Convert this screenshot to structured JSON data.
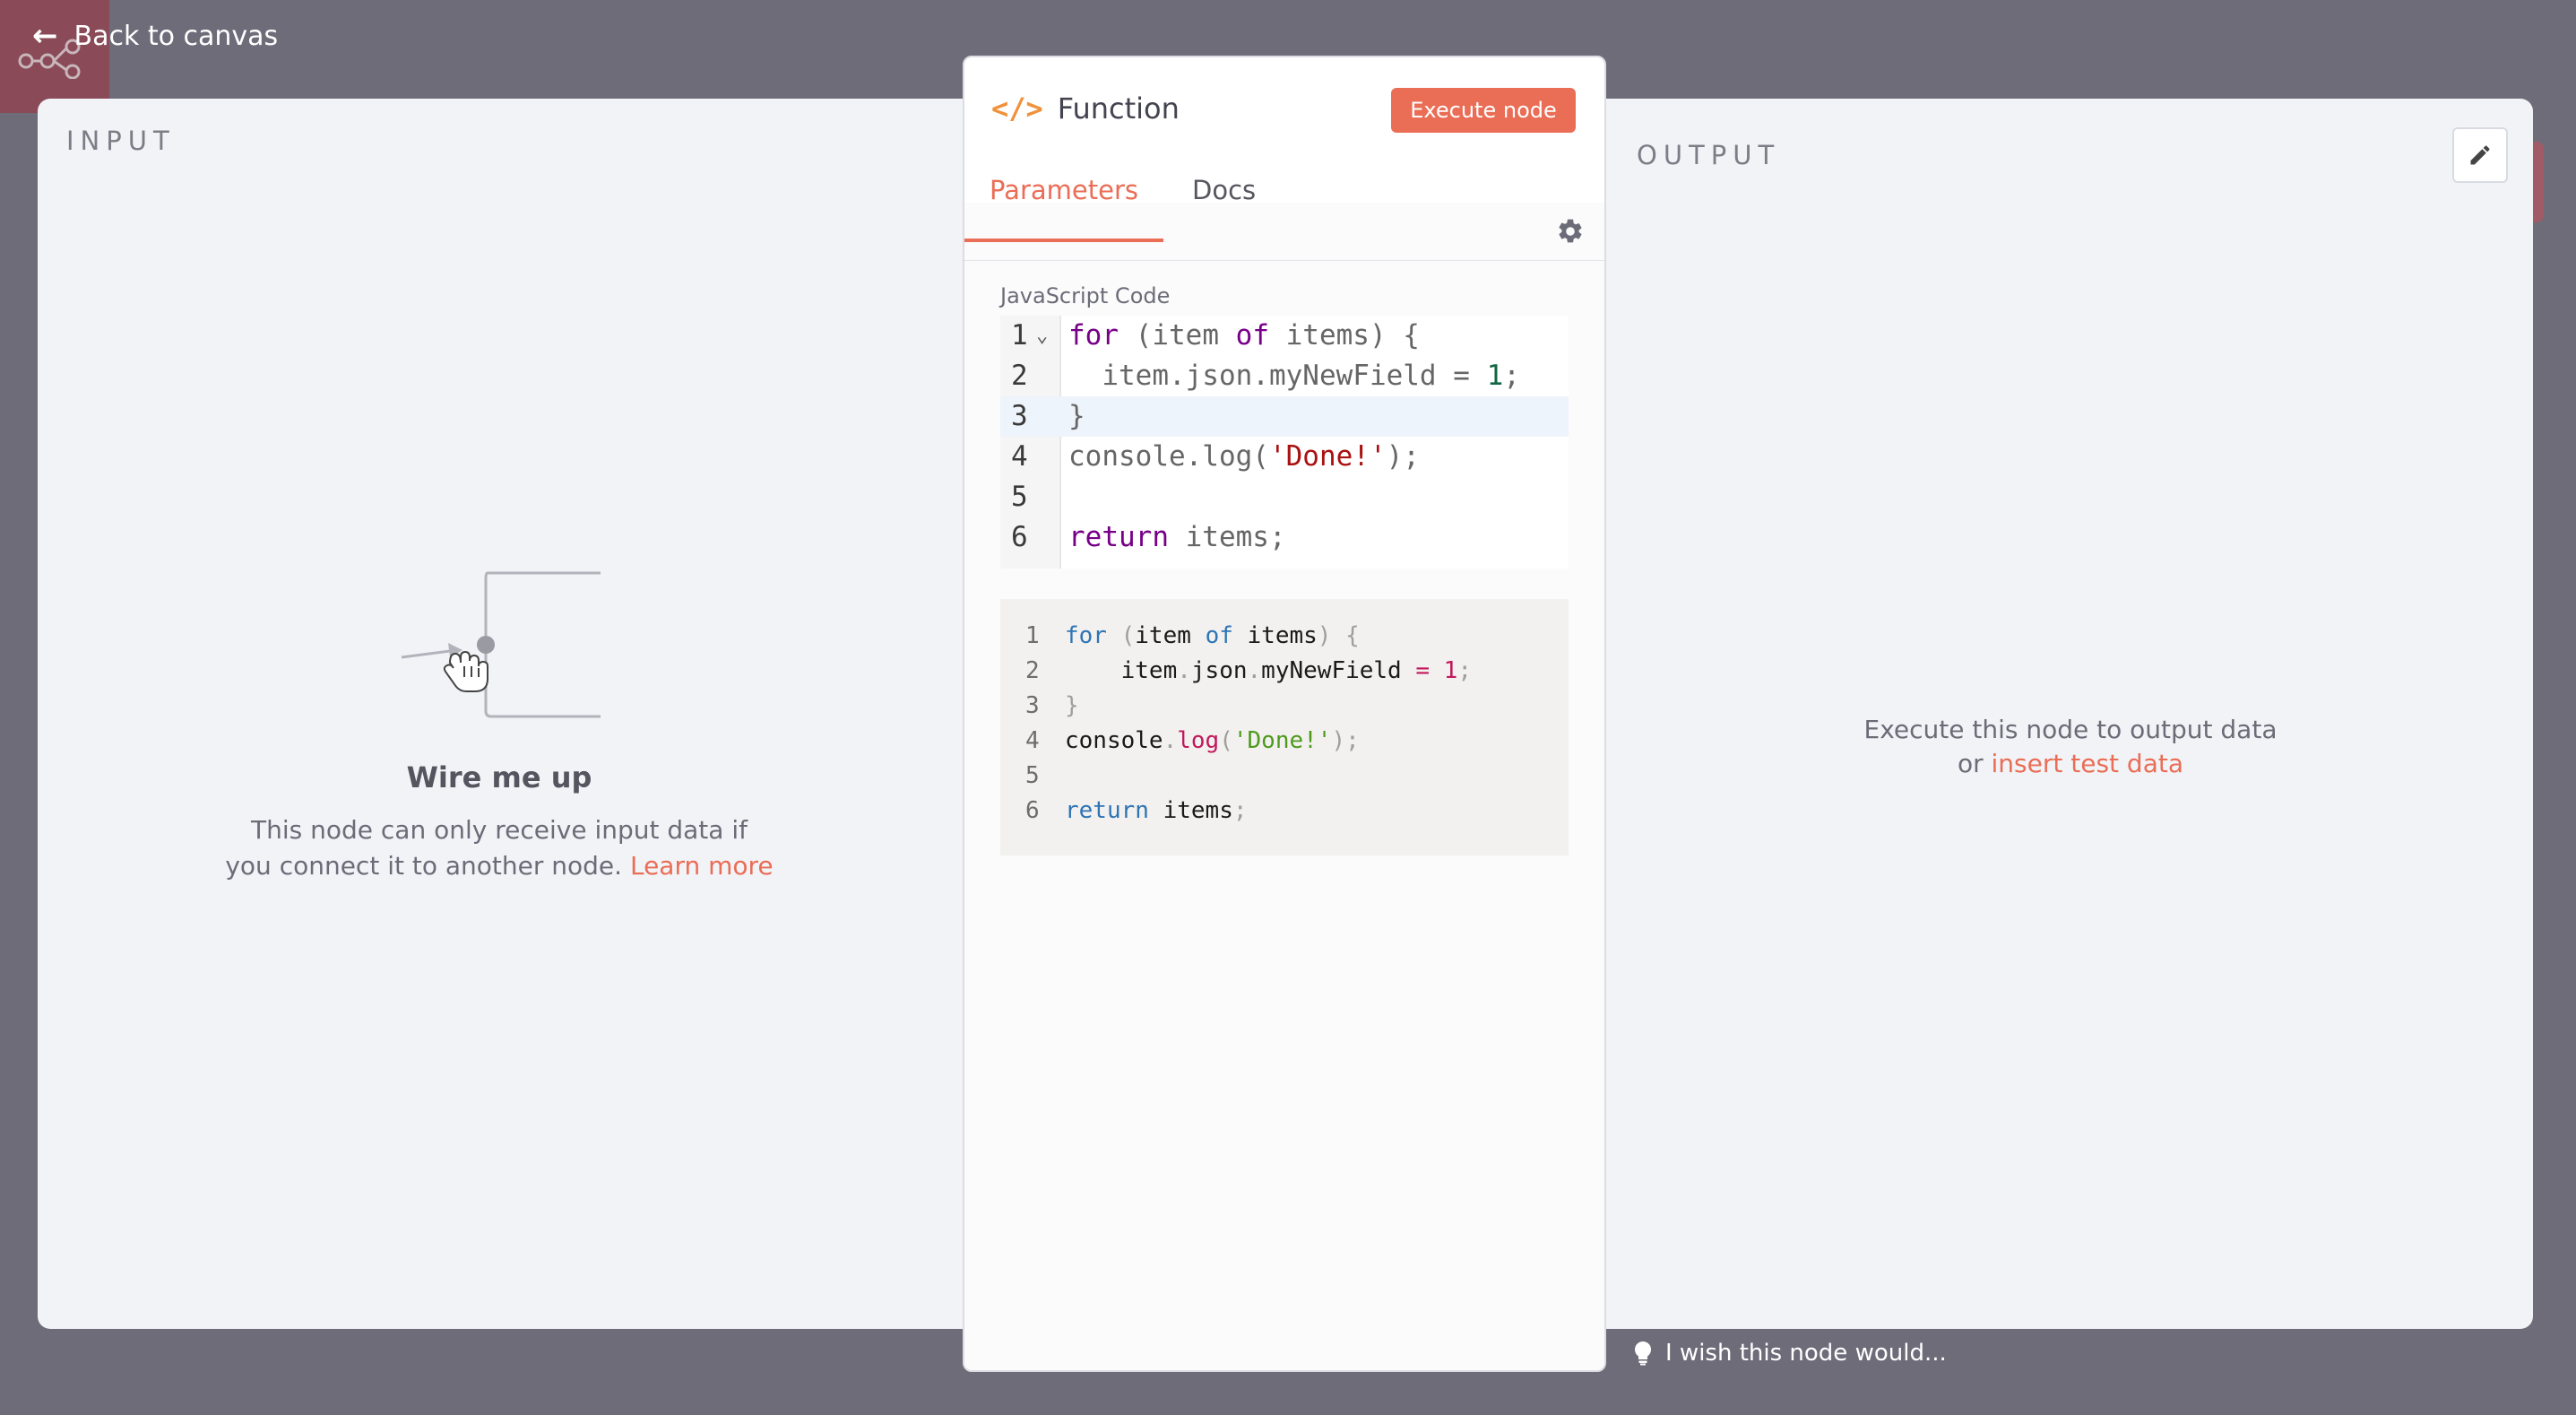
{
  "header": {
    "back_label": "Back to canvas"
  },
  "input_panel": {
    "label": "INPUT",
    "title": "Wire me up",
    "text": "This node can only receive input data if you connect it to another node.",
    "link": "Learn more"
  },
  "output_panel": {
    "label": "OUTPUT",
    "line1": "Execute this node to output data",
    "or": "or",
    "link": "insert test data"
  },
  "node": {
    "icon": "code-icon",
    "title": "Function",
    "execute_label": "Execute node",
    "tabs": [
      "Parameters",
      "Docs"
    ],
    "active_tab": "Parameters",
    "field_label": "JavaScript Code",
    "line_numbers": [
      "1",
      "2",
      "3",
      "4",
      "5",
      "6"
    ],
    "active_line": 3
  },
  "code_lines": [
    "for (item of items) {",
    "  item.json.myNewField = 1;",
    "}",
    "console.log('Done!');",
    "",
    "return items;"
  ],
  "preview_lines": [
    "for (item of items) {",
    "    item.json.myNewField = 1;",
    "}",
    "console.log('Done!');",
    "",
    "return items;"
  ],
  "feedback": {
    "label": "I wish this node would..."
  },
  "colors": {
    "accent": "#ea6d56",
    "node_icon": "#f0913c",
    "overlay": "#6f6c7a"
  }
}
